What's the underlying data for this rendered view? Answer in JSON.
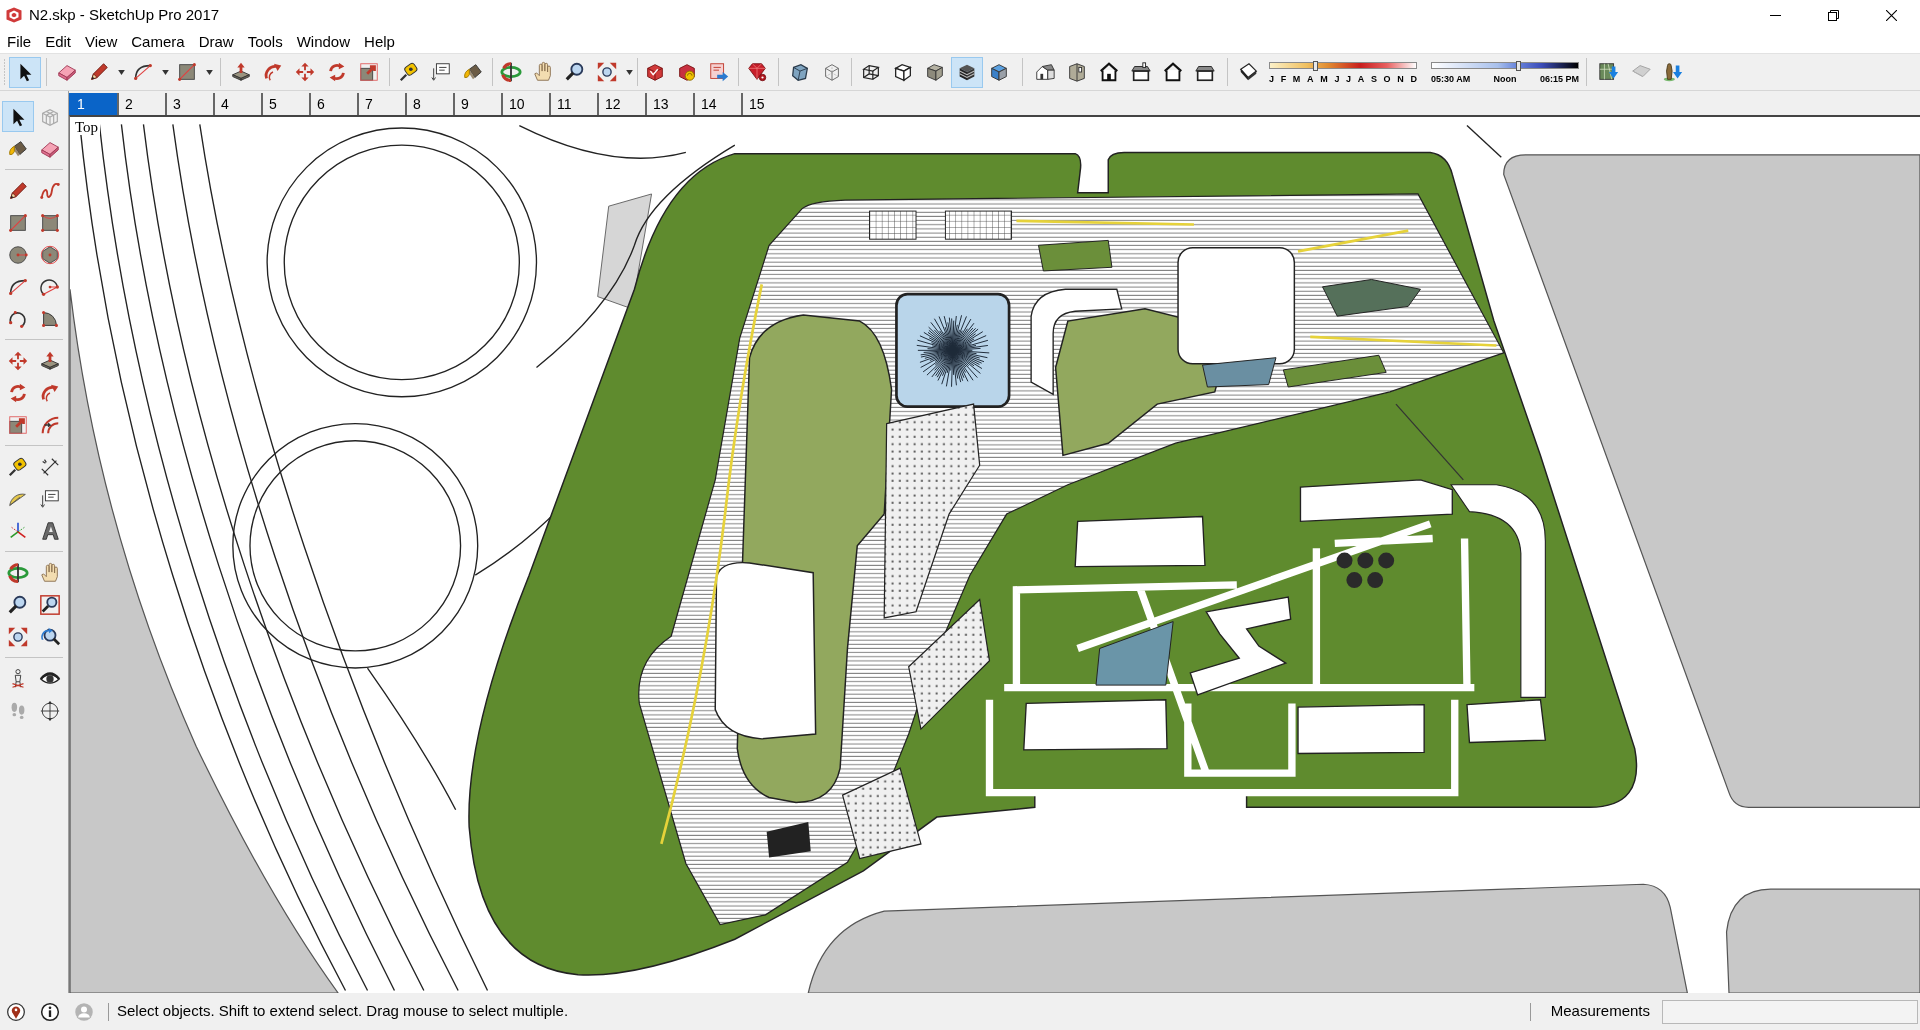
{
  "window": {
    "title": "N2.skp - SketchUp Pro 2017"
  },
  "menu_bar": [
    "File",
    "Edit",
    "View",
    "Camera",
    "Draw",
    "Tools",
    "Window",
    "Help"
  ],
  "toolbars": [
    {
      "buttons": [
        {
          "selected": true,
          "dropdown": false
        }
      ]
    },
    {
      "buttons": [
        {
          "selected": false,
          "dropdown": false
        },
        {
          "selected": false,
          "dropdown": true
        },
        {
          "selected": false,
          "dropdown": true
        },
        {
          "selected": false,
          "dropdown": true
        }
      ]
    },
    {
      "buttons": [
        {
          "selected": false,
          "dropdown": false
        },
        {
          "selected": false,
          "dropdown": false
        },
        {
          "selected": false,
          "dropdown": false
        },
        {
          "selected": false,
          "dropdown": false
        },
        {
          "selected": false,
          "dropdown": false
        }
      ]
    },
    {
      "buttons": [
        {
          "selected": false,
          "dropdown": false
        },
        {
          "selected": false,
          "dropdown": false
        },
        {
          "selected": false,
          "dropdown": false
        }
      ]
    },
    {
      "buttons": [
        {
          "selected": false,
          "dropdown": false
        },
        {
          "selected": false,
          "dropdown": false
        },
        {
          "selected": false,
          "dropdown": false
        },
        {
          "selected": false,
          "dropdown": true
        }
      ]
    },
    {
      "buttons": [
        {
          "selected": false,
          "dropdown": false
        },
        {
          "selected": false,
          "dropdown": false
        },
        {
          "selected": false,
          "dropdown": false
        }
      ]
    },
    {
      "buttons": [
        {
          "selected": false,
          "dropdown": false
        }
      ]
    },
    {
      "buttons": [
        {
          "selected": false,
          "dropdown": false
        },
        {
          "selected": false,
          "dropdown": false
        }
      ]
    },
    {
      "buttons": [
        {
          "selected": false,
          "dropdown": false
        },
        {
          "selected": false,
          "dropdown": false
        },
        {
          "selected": false,
          "dropdown": false
        },
        {
          "selected": true,
          "dropdown": false
        },
        {
          "selected": false,
          "dropdown": false
        }
      ]
    },
    {
      "buttons": [
        {
          "selected": false,
          "dropdown": false
        },
        {
          "selected": false,
          "dropdown": false
        },
        {
          "selected": false,
          "dropdown": false
        },
        {
          "selected": false,
          "dropdown": false
        },
        {
          "selected": false,
          "dropdown": false
        },
        {
          "selected": false,
          "dropdown": false
        }
      ]
    },
    {
      "buttons": [
        {
          "selected": false,
          "dropdown": false
        }
      ],
      "month_slider": {
        "level": 0.31
      },
      "month_labels": [
        "J",
        "F",
        "M",
        "A",
        "M",
        "J",
        "J",
        "A",
        "S",
        "O",
        "N",
        "D"
      ],
      "time_slider": {
        "level": 0.59
      },
      "time_labels": [
        "05:30 AM",
        "Noon",
        "06:15 PM"
      ]
    },
    {
      "buttons": [
        {
          "selected": false,
          "dropdown": false
        },
        {
          "selected": false,
          "dropdown": false
        },
        {
          "selected": false,
          "dropdown": false
        }
      ]
    }
  ],
  "scenes": [
    {
      "label": "1",
      "selected": true
    },
    {
      "label": "2",
      "selected": false
    },
    {
      "label": "3",
      "selected": false
    },
    {
      "label": "4",
      "selected": false
    },
    {
      "label": "5",
      "selected": false
    },
    {
      "label": "6",
      "selected": false
    },
    {
      "label": "7",
      "selected": false
    },
    {
      "label": "8",
      "selected": false
    },
    {
      "label": "9",
      "selected": false
    },
    {
      "label": "10",
      "selected": false
    },
    {
      "label": "11",
      "selected": false
    },
    {
      "label": "12",
      "selected": false
    },
    {
      "label": "13",
      "selected": false
    },
    {
      "label": "14",
      "selected": false
    },
    {
      "label": "15",
      "selected": false
    }
  ],
  "tool_palette": [
    {
      "tools": [
        {
          "selected": true
        },
        {
          "selected": false
        },
        {
          "selected": false
        },
        {
          "selected": false
        }
      ]
    },
    {
      "tools": [
        {
          "selected": false
        },
        {
          "selected": false
        },
        {
          "selected": false
        },
        {
          "selected": false
        },
        {
          "selected": false
        },
        {
          "selected": false
        },
        {
          "selected": false
        },
        {
          "selected": false
        },
        {
          "selected": false
        },
        {
          "selected": false
        }
      ]
    },
    {
      "tools": [
        {
          "selected": false
        },
        {
          "selected": false
        },
        {
          "selected": false
        },
        {
          "selected": false
        },
        {
          "selected": false
        },
        {
          "selected": false
        }
      ]
    },
    {
      "tools": [
        {
          "selected": false
        },
        {
          "selected": false
        },
        {
          "selected": false
        },
        {
          "selected": false
        },
        {
          "selected": false
        },
        {
          "selected": false
        }
      ]
    },
    {
      "tools": [
        {
          "selected": false
        },
        {
          "selected": false
        },
        {
          "selected": false
        },
        {
          "selected": false
        },
        {
          "selected": false
        },
        {
          "selected": false
        }
      ]
    },
    {
      "tools": [
        {
          "selected": false
        },
        {
          "selected": false
        },
        {
          "selected": false
        },
        {
          "selected": false
        }
      ]
    }
  ],
  "viewport": {
    "view_name": "Top"
  },
  "status_bar": {
    "message": "Select objects. Shift to extend select. Drag mouse to select multiple.",
    "measurements_label": "Measurements"
  }
}
